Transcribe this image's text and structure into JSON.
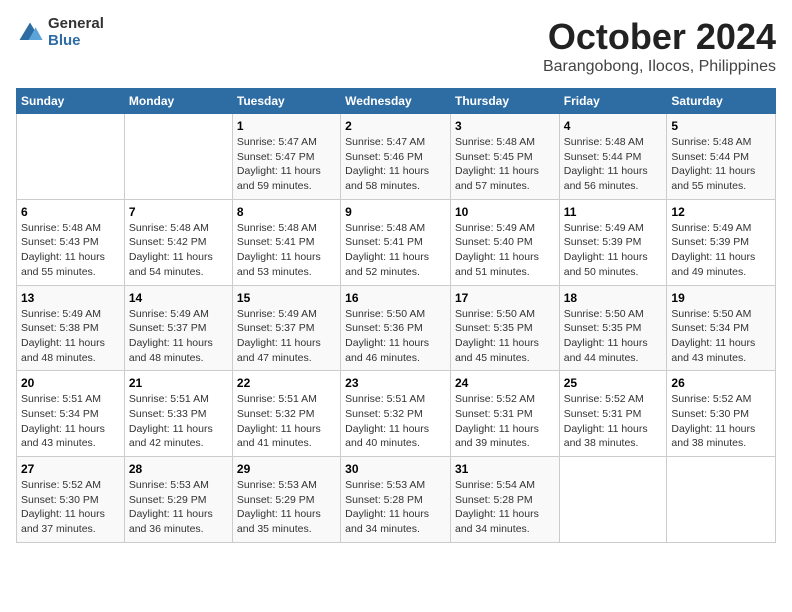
{
  "header": {
    "logo_general": "General",
    "logo_blue": "Blue",
    "title": "October 2024",
    "subtitle": "Barangobong, Ilocos, Philippines"
  },
  "calendar": {
    "days_of_week": [
      "Sunday",
      "Monday",
      "Tuesday",
      "Wednesday",
      "Thursday",
      "Friday",
      "Saturday"
    ],
    "weeks": [
      [
        {
          "day": "",
          "info": ""
        },
        {
          "day": "",
          "info": ""
        },
        {
          "day": "1",
          "info": "Sunrise: 5:47 AM\nSunset: 5:47 PM\nDaylight: 11 hours and 59 minutes."
        },
        {
          "day": "2",
          "info": "Sunrise: 5:47 AM\nSunset: 5:46 PM\nDaylight: 11 hours and 58 minutes."
        },
        {
          "day": "3",
          "info": "Sunrise: 5:48 AM\nSunset: 5:45 PM\nDaylight: 11 hours and 57 minutes."
        },
        {
          "day": "4",
          "info": "Sunrise: 5:48 AM\nSunset: 5:44 PM\nDaylight: 11 hours and 56 minutes."
        },
        {
          "day": "5",
          "info": "Sunrise: 5:48 AM\nSunset: 5:44 PM\nDaylight: 11 hours and 55 minutes."
        }
      ],
      [
        {
          "day": "6",
          "info": "Sunrise: 5:48 AM\nSunset: 5:43 PM\nDaylight: 11 hours and 55 minutes."
        },
        {
          "day": "7",
          "info": "Sunrise: 5:48 AM\nSunset: 5:42 PM\nDaylight: 11 hours and 54 minutes."
        },
        {
          "day": "8",
          "info": "Sunrise: 5:48 AM\nSunset: 5:41 PM\nDaylight: 11 hours and 53 minutes."
        },
        {
          "day": "9",
          "info": "Sunrise: 5:48 AM\nSunset: 5:41 PM\nDaylight: 11 hours and 52 minutes."
        },
        {
          "day": "10",
          "info": "Sunrise: 5:49 AM\nSunset: 5:40 PM\nDaylight: 11 hours and 51 minutes."
        },
        {
          "day": "11",
          "info": "Sunrise: 5:49 AM\nSunset: 5:39 PM\nDaylight: 11 hours and 50 minutes."
        },
        {
          "day": "12",
          "info": "Sunrise: 5:49 AM\nSunset: 5:39 PM\nDaylight: 11 hours and 49 minutes."
        }
      ],
      [
        {
          "day": "13",
          "info": "Sunrise: 5:49 AM\nSunset: 5:38 PM\nDaylight: 11 hours and 48 minutes."
        },
        {
          "day": "14",
          "info": "Sunrise: 5:49 AM\nSunset: 5:37 PM\nDaylight: 11 hours and 48 minutes."
        },
        {
          "day": "15",
          "info": "Sunrise: 5:49 AM\nSunset: 5:37 PM\nDaylight: 11 hours and 47 minutes."
        },
        {
          "day": "16",
          "info": "Sunrise: 5:50 AM\nSunset: 5:36 PM\nDaylight: 11 hours and 46 minutes."
        },
        {
          "day": "17",
          "info": "Sunrise: 5:50 AM\nSunset: 5:35 PM\nDaylight: 11 hours and 45 minutes."
        },
        {
          "day": "18",
          "info": "Sunrise: 5:50 AM\nSunset: 5:35 PM\nDaylight: 11 hours and 44 minutes."
        },
        {
          "day": "19",
          "info": "Sunrise: 5:50 AM\nSunset: 5:34 PM\nDaylight: 11 hours and 43 minutes."
        }
      ],
      [
        {
          "day": "20",
          "info": "Sunrise: 5:51 AM\nSunset: 5:34 PM\nDaylight: 11 hours and 43 minutes."
        },
        {
          "day": "21",
          "info": "Sunrise: 5:51 AM\nSunset: 5:33 PM\nDaylight: 11 hours and 42 minutes."
        },
        {
          "day": "22",
          "info": "Sunrise: 5:51 AM\nSunset: 5:32 PM\nDaylight: 11 hours and 41 minutes."
        },
        {
          "day": "23",
          "info": "Sunrise: 5:51 AM\nSunset: 5:32 PM\nDaylight: 11 hours and 40 minutes."
        },
        {
          "day": "24",
          "info": "Sunrise: 5:52 AM\nSunset: 5:31 PM\nDaylight: 11 hours and 39 minutes."
        },
        {
          "day": "25",
          "info": "Sunrise: 5:52 AM\nSunset: 5:31 PM\nDaylight: 11 hours and 38 minutes."
        },
        {
          "day": "26",
          "info": "Sunrise: 5:52 AM\nSunset: 5:30 PM\nDaylight: 11 hours and 38 minutes."
        }
      ],
      [
        {
          "day": "27",
          "info": "Sunrise: 5:52 AM\nSunset: 5:30 PM\nDaylight: 11 hours and 37 minutes."
        },
        {
          "day": "28",
          "info": "Sunrise: 5:53 AM\nSunset: 5:29 PM\nDaylight: 11 hours and 36 minutes."
        },
        {
          "day": "29",
          "info": "Sunrise: 5:53 AM\nSunset: 5:29 PM\nDaylight: 11 hours and 35 minutes."
        },
        {
          "day": "30",
          "info": "Sunrise: 5:53 AM\nSunset: 5:28 PM\nDaylight: 11 hours and 34 minutes."
        },
        {
          "day": "31",
          "info": "Sunrise: 5:54 AM\nSunset: 5:28 PM\nDaylight: 11 hours and 34 minutes."
        },
        {
          "day": "",
          "info": ""
        },
        {
          "day": "",
          "info": ""
        }
      ]
    ]
  }
}
